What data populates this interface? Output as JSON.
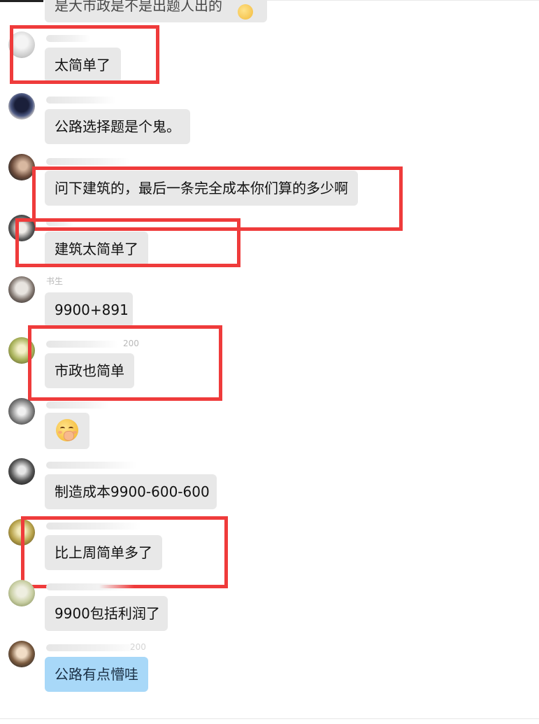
{
  "chat": {
    "partial_top_text": "是大市政是不是出题人出的",
    "messages": [
      {
        "text": "太简单了"
      },
      {
        "text": "公路选择题是个鬼。"
      },
      {
        "text": "问下建筑的，最后一条完全成本你们算的多少啊"
      },
      {
        "text": "建筑太简单了"
      },
      {
        "sender_fragment": "书生",
        "text": "9900+891"
      },
      {
        "sender_fragment": "200",
        "text": "市政也简单"
      },
      {
        "text": "",
        "emoji": "shushing-face-emoji"
      },
      {
        "text": "制造成本9900-600-600"
      },
      {
        "text": "比上周简单多了"
      },
      {
        "text": "9900包括利润了"
      },
      {
        "sender_fragment": "200",
        "text": "公路有点懵哇"
      }
    ]
  },
  "colors": {
    "highlight_box": "#ef3b3b",
    "bubble_gray": "#e8e8e8",
    "bubble_blue": "#a8d8f8"
  }
}
